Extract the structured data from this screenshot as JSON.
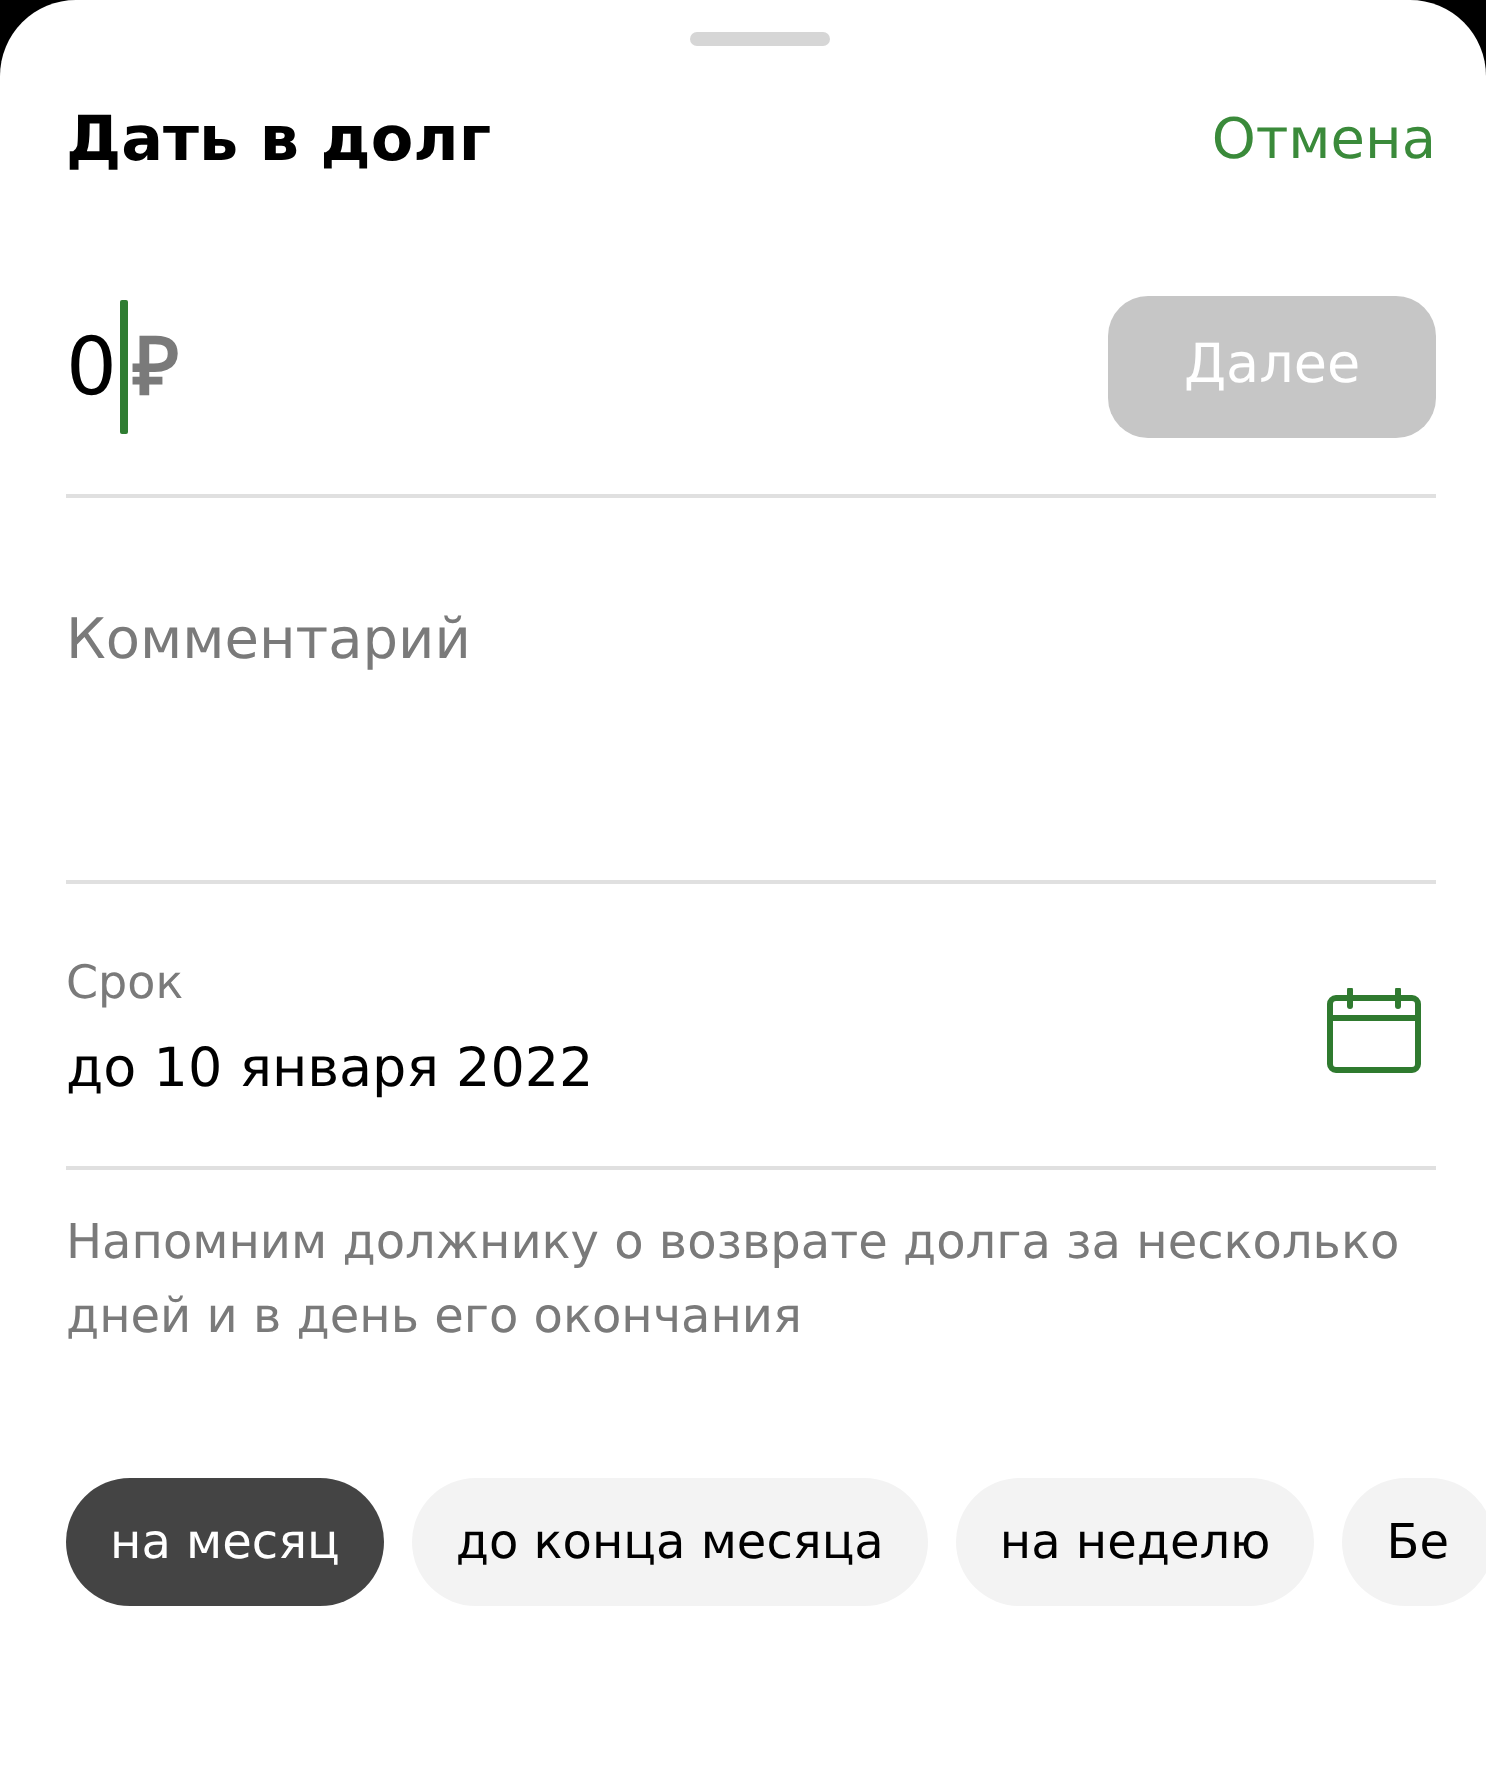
{
  "sheet": {
    "title": "Дать в долг",
    "cancel": "Отмена"
  },
  "amount": {
    "value": "0",
    "currency": "₽",
    "focused": true
  },
  "next_button": {
    "label": "Далее",
    "disabled": true
  },
  "comment": {
    "placeholder": "Комментарий"
  },
  "deadline": {
    "label": "Срок",
    "value": "до 10 января 2022"
  },
  "note": "Напомним должнику о возврате долга за несколько дней и в день его окончания",
  "periods": [
    {
      "label": "на месяц",
      "selected": true
    },
    {
      "label": "до конца месяца",
      "selected": false
    },
    {
      "label": "на неделю",
      "selected": false
    },
    {
      "label": "Бе",
      "selected": false
    }
  ]
}
